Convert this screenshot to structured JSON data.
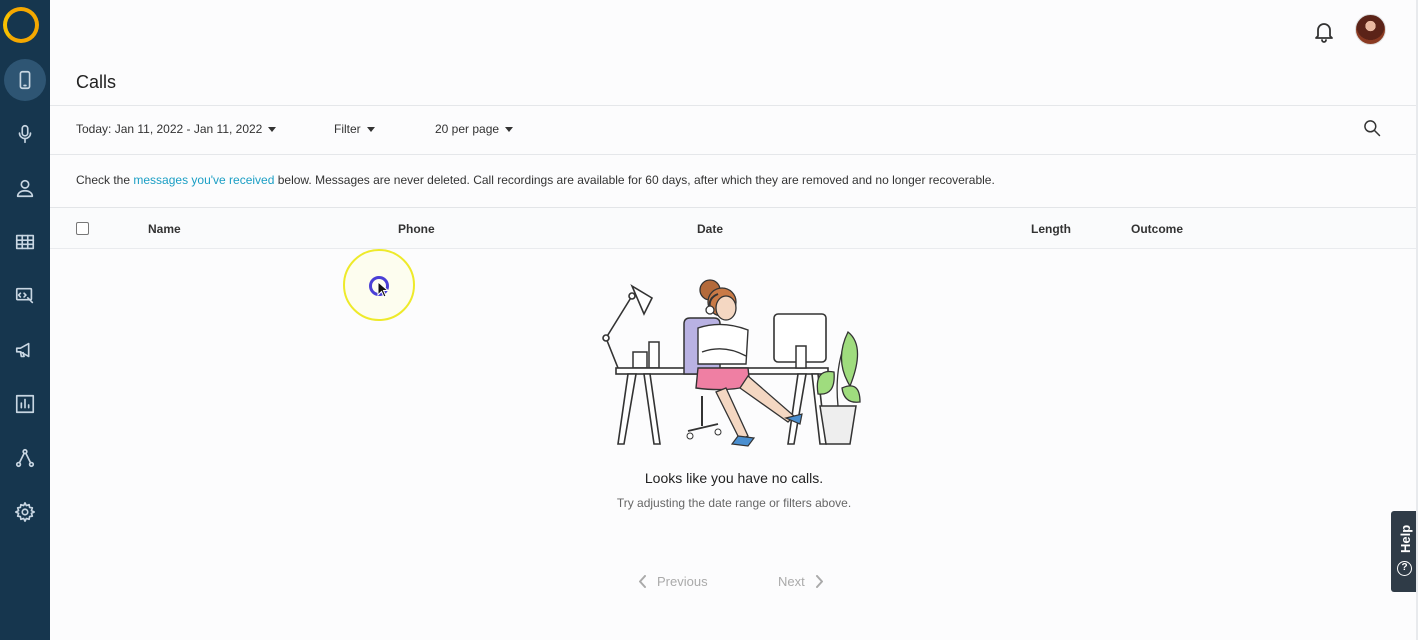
{
  "page": {
    "title": "Calls"
  },
  "sidebar": {
    "items": [
      {
        "icon": "phone-icon",
        "active": true
      },
      {
        "icon": "microphone-icon",
        "active": false
      },
      {
        "icon": "user-icon",
        "active": false
      },
      {
        "icon": "table-icon",
        "active": false
      },
      {
        "icon": "widget-icon",
        "active": false
      },
      {
        "icon": "megaphone-icon",
        "active": false
      },
      {
        "icon": "bar-chart-icon",
        "active": false
      },
      {
        "icon": "integrations-icon",
        "active": false
      },
      {
        "icon": "gear-icon",
        "active": false
      }
    ]
  },
  "header": {
    "notifications_icon": "bell-icon",
    "avatar": "user-avatar"
  },
  "toolbar": {
    "date_range": "Today: Jan 11, 2022 - Jan 11, 2022",
    "filter": "Filter",
    "per_page": "20 per page",
    "search_icon": "search-icon"
  },
  "info": {
    "prefix": "Check the ",
    "link": "messages you've received",
    "suffix": " below. Messages are never deleted. Call recordings are available for 60 days, after which they are removed and no longer recoverable."
  },
  "table": {
    "columns": [
      "Name",
      "Phone",
      "Date",
      "Length",
      "Outcome"
    ]
  },
  "empty_state": {
    "title": "Looks like you have no calls.",
    "subtitle": "Try adjusting the date range or filters above."
  },
  "pagination": {
    "previous": "Previous",
    "next": "Next"
  },
  "help": {
    "label": "Help"
  },
  "colors": {
    "sidebar": "#16364e",
    "link": "#1a9ec4",
    "accent_logo": "#f5a800"
  }
}
